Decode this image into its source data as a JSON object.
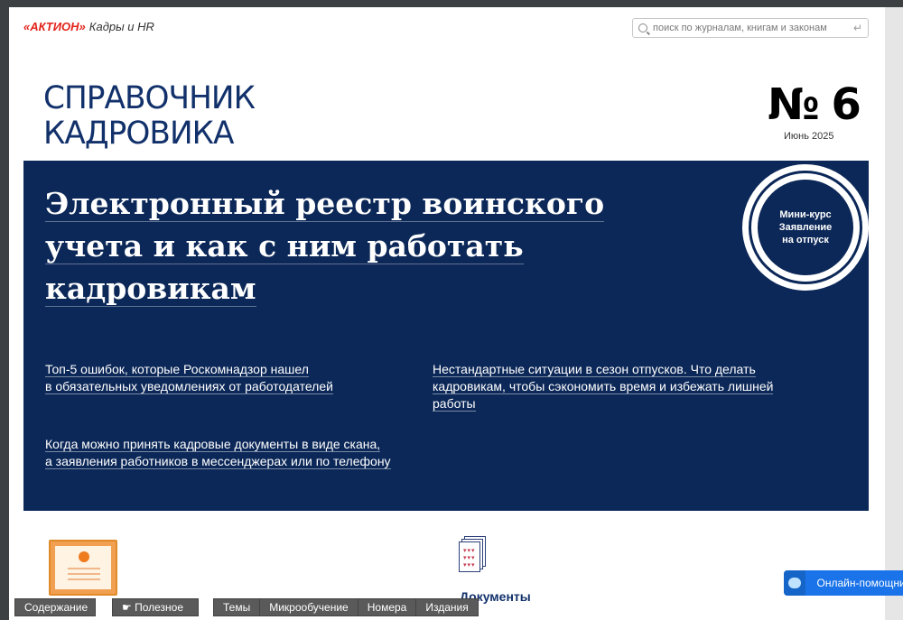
{
  "header": {
    "brand": "«АКТИОН»",
    "section": "Кадры и HR",
    "search_placeholder": "поиск по журналам, книгам и законам"
  },
  "magazine": {
    "title_line1": "СПРАВОЧНИК",
    "title_line2": "КАДРОВИКА",
    "issue_number": "№ 6",
    "issue_date": "Июнь 2025"
  },
  "banner": {
    "headline_line1": "Электронный реестр воинского",
    "headline_line2": "учета и как с ним работать",
    "headline_line3": "кадровикам",
    "badge_line1": "Мини-курс",
    "badge_line2": "Заявление",
    "badge_line3": "на отпуск",
    "links": [
      {
        "line1": "Топ-5 ошибок, которые Роскомнадзор нашел",
        "line2": "в обязательных уведомлениях от работодателей"
      },
      {
        "line1": "Нестандартные ситуации в сезон отпусков. Что делать",
        "line2": "кадровикам, чтобы сэкономить время и избежать лишней",
        "line3": "работы"
      },
      {
        "line1": "Когда можно принять кадровые документы в виде скана,",
        "line2": "а заявления работников в мессенджерах или по телефону"
      }
    ]
  },
  "sections": {
    "documents_title": "Документы"
  },
  "toolbar": {
    "contents": "Содержание",
    "useful": "Полезное",
    "themes": "Темы",
    "microlearning": "Микрообучение",
    "issues": "Номера",
    "editions": "Издания"
  },
  "chat": {
    "label": "Онлайн-помощник"
  },
  "colors": {
    "brand_red": "#e2231a",
    "navy": "#0c2858",
    "title_blue": "#12316b"
  }
}
